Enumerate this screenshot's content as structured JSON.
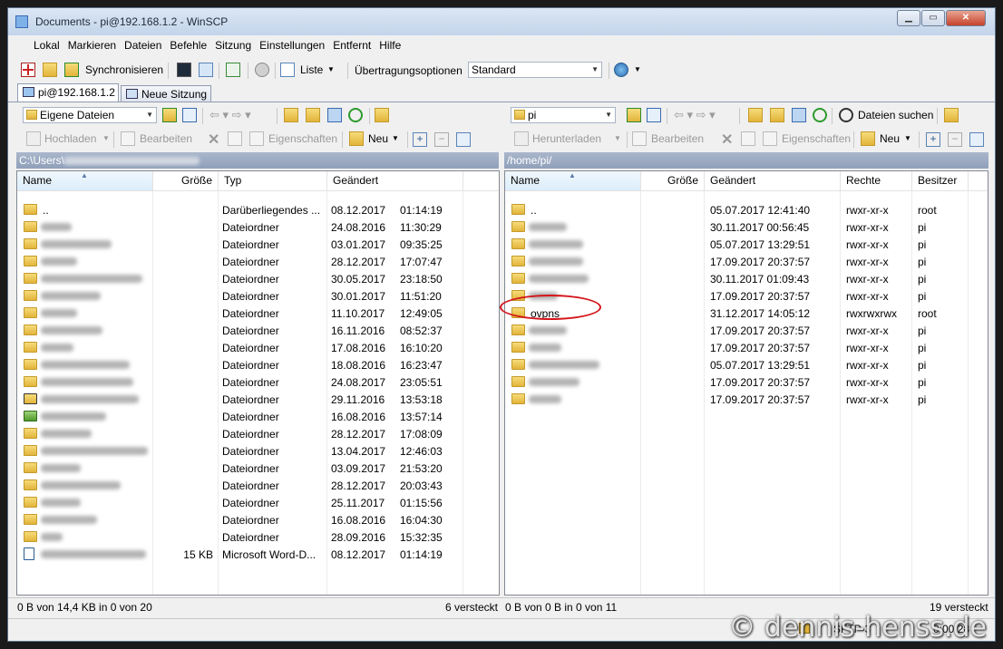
{
  "window": {
    "title": "Documents - pi@192.168.1.2 - WinSCP",
    "min_glyph": "▁",
    "max_glyph": "▭",
    "close_glyph": "✕"
  },
  "menu": [
    "Lokal",
    "Markieren",
    "Dateien",
    "Befehle",
    "Sitzung",
    "Einstellungen",
    "Entfernt",
    "Hilfe"
  ],
  "toolbar": {
    "sync_label": "Synchronisieren",
    "list_label": "Liste",
    "transfer_options_label": "Übertragungsoptionen",
    "transfer_options_value": "Standard"
  },
  "tabs": {
    "session": "pi@192.168.1.2",
    "new_session": "Neue Sitzung"
  },
  "left": {
    "location": "Eigene Dateien",
    "actions": {
      "upload": "Hochladen",
      "edit": "Bearbeiten",
      "properties": "Eigenschaften",
      "new": "Neu"
    },
    "path": "C:\\Users\\",
    "columns": {
      "name": "Name",
      "size": "Größe",
      "type": "Typ",
      "changed": "Geändert"
    },
    "rows": [
      {
        "name": "..",
        "size": "",
        "type": "Darüberliegendes ...",
        "date": "08.12.2017",
        "time": "01:14:19",
        "icon": "up",
        "blur": 0
      },
      {
        "name": "",
        "size": "",
        "type": "Dateiordner",
        "date": "24.08.2016",
        "time": "11:30:29",
        "icon": "folder",
        "blur": 34
      },
      {
        "name": "",
        "size": "",
        "type": "Dateiordner",
        "date": "03.01.2017",
        "time": "09:35:25",
        "icon": "folder",
        "blur": 78
      },
      {
        "name": "",
        "size": "",
        "type": "Dateiordner",
        "date": "28.12.2017",
        "time": "17:07:47",
        "icon": "folder",
        "blur": 40
      },
      {
        "name": "",
        "size": "",
        "type": "Dateiordner",
        "date": "30.05.2017",
        "time": "23:18:50",
        "icon": "folder",
        "blur": 112
      },
      {
        "name": "",
        "size": "",
        "type": "Dateiordner",
        "date": "30.01.2017",
        "time": "11:51:20",
        "icon": "folder",
        "blur": 66
      },
      {
        "name": "",
        "size": "",
        "type": "Dateiordner",
        "date": "11.10.2017",
        "time": "12:49:05",
        "icon": "folder",
        "blur": 40
      },
      {
        "name": "",
        "size": "",
        "type": "Dateiordner",
        "date": "16.11.2016",
        "time": "08:52:37",
        "icon": "folder",
        "blur": 68
      },
      {
        "name": "",
        "size": "",
        "type": "Dateiordner",
        "date": "17.08.2016",
        "time": "16:10:20",
        "icon": "folder",
        "blur": 36
      },
      {
        "name": "",
        "size": "",
        "type": "Dateiordner",
        "date": "18.08.2016",
        "time": "16:23:47",
        "icon": "folder",
        "blur": 98
      },
      {
        "name": "",
        "size": "",
        "type": "Dateiordner",
        "date": "24.08.2017",
        "time": "23:05:51",
        "icon": "folder",
        "blur": 102
      },
      {
        "name": "",
        "size": "",
        "type": "Dateiordner",
        "date": "29.11.2016",
        "time": "13:53:18",
        "icon": "folder-special",
        "blur": 108
      },
      {
        "name": "",
        "size": "",
        "type": "Dateiordner",
        "date": "16.08.2016",
        "time": "13:57:14",
        "icon": "folder-green",
        "blur": 72
      },
      {
        "name": "",
        "size": "",
        "type": "Dateiordner",
        "date": "28.12.2017",
        "time": "17:08:09",
        "icon": "folder",
        "blur": 56
      },
      {
        "name": "",
        "size": "",
        "type": "Dateiordner",
        "date": "13.04.2017",
        "time": "12:46:03",
        "icon": "folder",
        "blur": 118
      },
      {
        "name": "",
        "size": "",
        "type": "Dateiordner",
        "date": "03.09.2017",
        "time": "21:53:20",
        "icon": "folder",
        "blur": 44
      },
      {
        "name": "",
        "size": "",
        "type": "Dateiordner",
        "date": "28.12.2017",
        "time": "20:03:43",
        "icon": "folder",
        "blur": 88
      },
      {
        "name": "",
        "size": "",
        "type": "Dateiordner",
        "date": "25.11.2017",
        "time": "01:15:56",
        "icon": "folder",
        "blur": 44
      },
      {
        "name": "",
        "size": "",
        "type": "Dateiordner",
        "date": "16.08.2016",
        "time": "16:04:30",
        "icon": "folder",
        "blur": 62
      },
      {
        "name": "",
        "size": "",
        "type": "Dateiordner",
        "date": "28.09.2016",
        "time": "15:32:35",
        "icon": "folder",
        "blur": 24
      },
      {
        "name": "",
        "size": "15 KB",
        "type": "Microsoft Word-D...",
        "date": "08.12.2017",
        "time": "01:14:19",
        "icon": "word",
        "blur": 116
      }
    ],
    "status": "0 B von 14,4 KB in 0 von 20",
    "hidden": "6 versteckt"
  },
  "right": {
    "location": "pi",
    "find_files": "Dateien suchen",
    "actions": {
      "download": "Herunterladen",
      "edit": "Bearbeiten",
      "properties": "Eigenschaften",
      "new": "Neu"
    },
    "path": "/home/pi/",
    "columns": {
      "name": "Name",
      "size": "Größe",
      "changed": "Geändert",
      "rights": "Rechte",
      "owner": "Besitzer"
    },
    "rows": [
      {
        "name": "..",
        "changed": "05.07.2017 12:41:40",
        "rights": "rwxr-xr-x",
        "owner": "root",
        "blur": 0
      },
      {
        "name": "",
        "changed": "30.11.2017 00:56:45",
        "rights": "rwxr-xr-x",
        "owner": "pi",
        "blur": 42
      },
      {
        "name": "",
        "changed": "05.07.2017 13:29:51",
        "rights": "rwxr-xr-x",
        "owner": "pi",
        "blur": 60
      },
      {
        "name": "",
        "changed": "17.09.2017 20:37:57",
        "rights": "rwxr-xr-x",
        "owner": "pi",
        "blur": 60
      },
      {
        "name": "",
        "changed": "30.11.2017 01:09:43",
        "rights": "rwxr-xr-x",
        "owner": "pi",
        "blur": 66
      },
      {
        "name": "",
        "changed": "17.09.2017 20:37:57",
        "rights": "rwxr-xr-x",
        "owner": "pi",
        "blur": 32
      },
      {
        "name": "ovpns",
        "changed": "31.12.2017 14:05:12",
        "rights": "rwxrwxrwx",
        "owner": "root",
        "blur": 0
      },
      {
        "name": "",
        "changed": "17.09.2017 20:37:57",
        "rights": "rwxr-xr-x",
        "owner": "pi",
        "blur": 42
      },
      {
        "name": "",
        "changed": "17.09.2017 20:37:57",
        "rights": "rwxr-xr-x",
        "owner": "pi",
        "blur": 36
      },
      {
        "name": "",
        "changed": "05.07.2017 13:29:51",
        "rights": "rwxr-xr-x",
        "owner": "pi",
        "blur": 78
      },
      {
        "name": "",
        "changed": "17.09.2017 20:37:57",
        "rights": "rwxr-xr-x",
        "owner": "pi",
        "blur": 56
      },
      {
        "name": "",
        "changed": "17.09.2017 20:37:57",
        "rights": "rwxr-xr-x",
        "owner": "pi",
        "blur": 36
      }
    ],
    "status": "0 B von 0 B in 0 von 11",
    "hidden": "19 versteckt"
  },
  "bottom": {
    "protocol": "SFTP-3",
    "elapsed": "0:00:28"
  },
  "watermark": "© dennis-henss.de",
  "colors": {
    "highlight_ring": "#d4141a",
    "path_bar": "#9aaac2"
  }
}
